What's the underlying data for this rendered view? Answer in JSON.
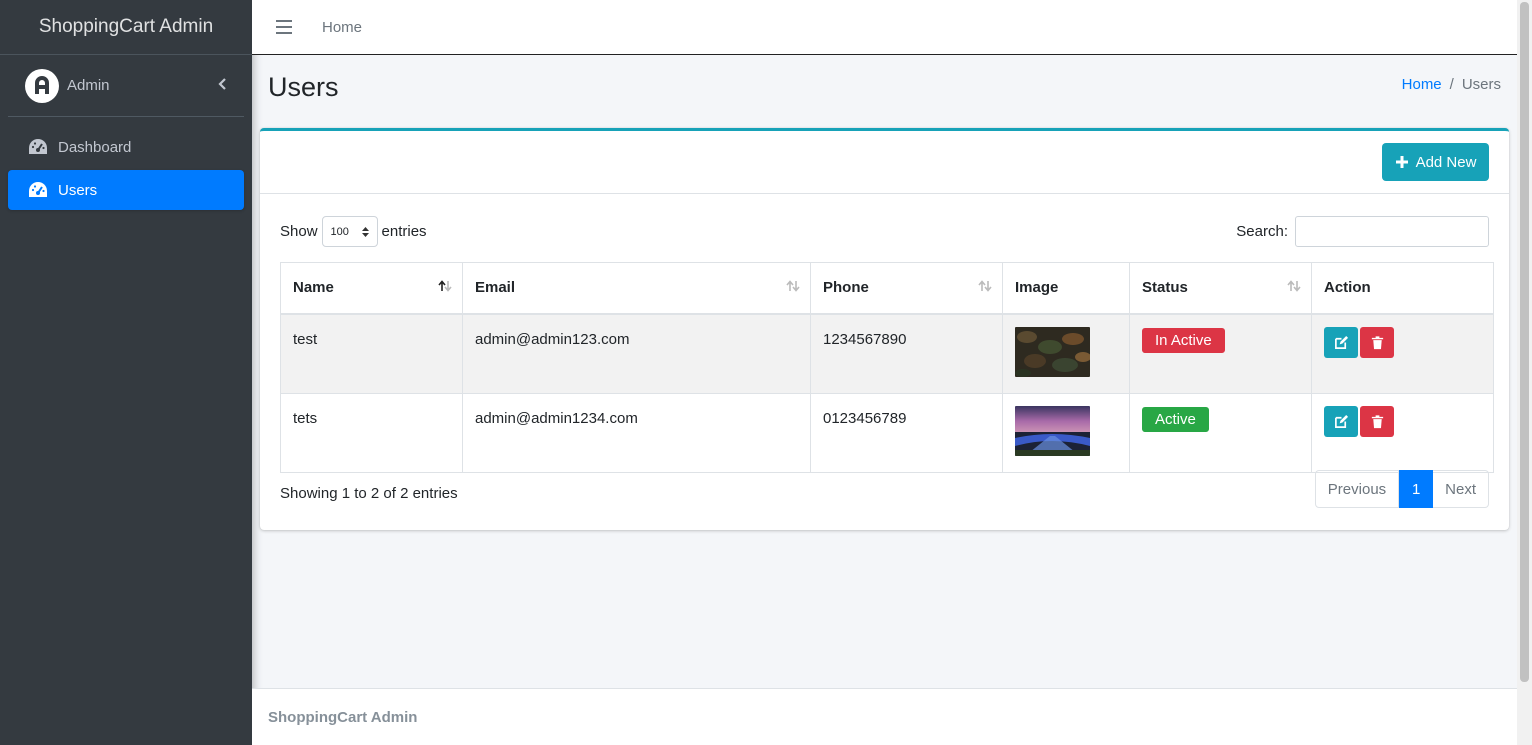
{
  "brand": {
    "title": "ShoppingCart Admin"
  },
  "user": {
    "name": "Admin"
  },
  "sidebar": {
    "items": [
      {
        "label": "Dashboard",
        "icon": "tachometer-icon"
      },
      {
        "label": "Users",
        "icon": "tachometer-icon",
        "active": true
      }
    ]
  },
  "topbar": {
    "home_label": "Home"
  },
  "page": {
    "title": "Users"
  },
  "breadcrumb": {
    "home": "Home",
    "separator": "/",
    "current": "Users"
  },
  "card": {
    "add_label": "Add New",
    "show_label": "Show",
    "entries_label": "entries",
    "page_length": "100",
    "search_label": "Search:",
    "search_value": ""
  },
  "table": {
    "columns": [
      "Name",
      "Email",
      "Phone",
      "Image",
      "Status",
      "Action"
    ],
    "rows": [
      {
        "name": "test",
        "email": "admin@admin123.com",
        "phone": "1234567890",
        "image": "leaves-thumbnail",
        "status": "In Active"
      },
      {
        "name": "tets",
        "email": "admin@admin1234.com",
        "phone": "0123456789",
        "image": "landscape-thumbnail",
        "status": "Active"
      }
    ]
  },
  "pagination": {
    "info": "Showing 1 to 2 of 2 entries",
    "previous": "Previous",
    "current": "1",
    "next": "Next"
  },
  "footer": {
    "text": "ShoppingCart Admin"
  },
  "colors": {
    "sidebar_bg": "#343a40",
    "primary": "#007bff",
    "info": "#17a2b8",
    "danger": "#dc3545",
    "success": "#28a745"
  }
}
